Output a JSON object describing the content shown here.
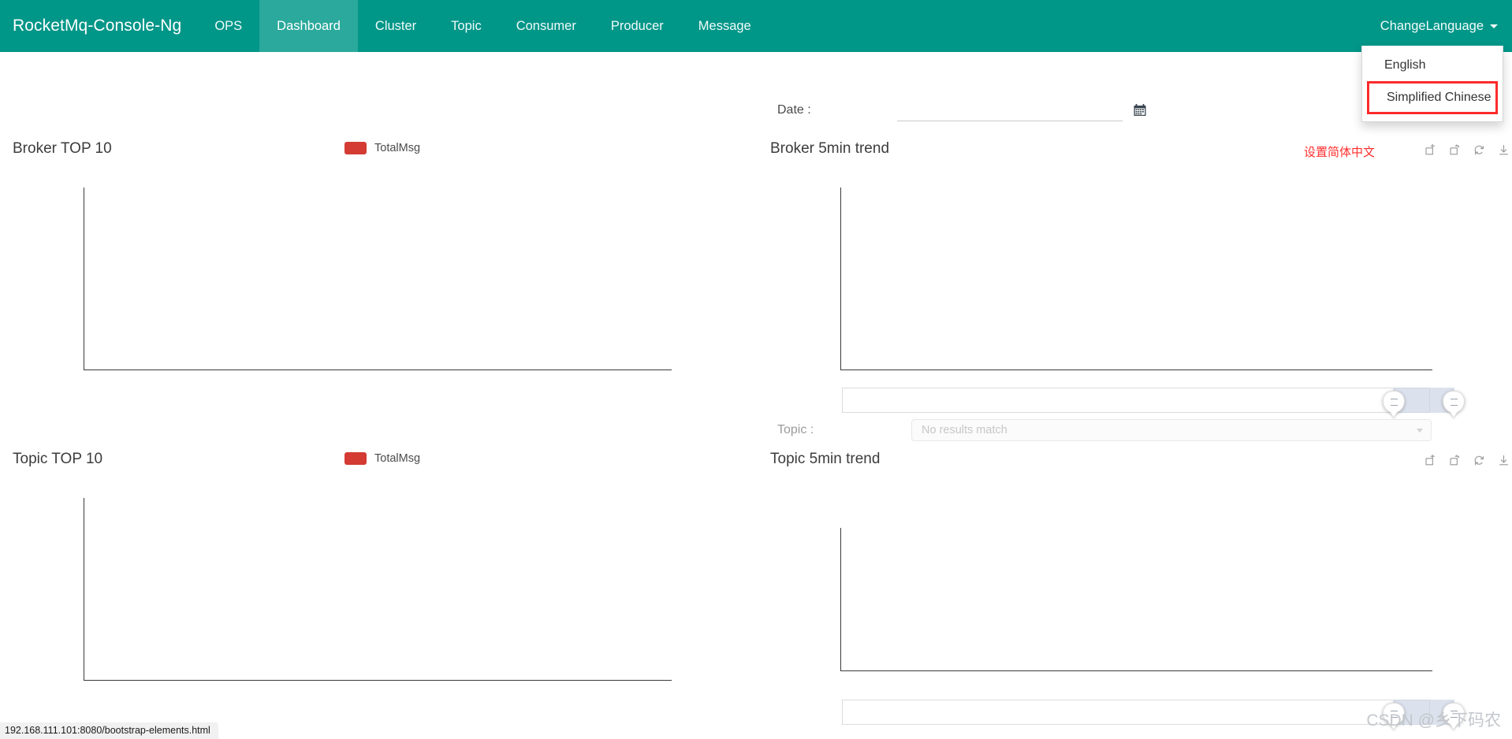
{
  "navbar": {
    "brand": "RocketMq-Console-Ng",
    "bg_color": "#009688",
    "active_color": "#2aa99c",
    "links": [
      {
        "label": "OPS",
        "active": false
      },
      {
        "label": "Dashboard",
        "active": true
      },
      {
        "label": "Cluster",
        "active": false
      },
      {
        "label": "Topic",
        "active": false
      },
      {
        "label": "Consumer",
        "active": false
      },
      {
        "label": "Producer",
        "active": false
      },
      {
        "label": "Message",
        "active": false
      }
    ],
    "language_toggle": "ChangeLanguage"
  },
  "language_menu": {
    "open": true,
    "items": [
      {
        "label": "English",
        "highlighted": false
      },
      {
        "label": "Simplified Chinese",
        "highlighted": true
      }
    ],
    "highlight_color": "#fc2b2b"
  },
  "filters": {
    "date_label": "Date :",
    "date_value": "",
    "date_placeholder": "",
    "calendar_icon": "calendar-icon",
    "topic_label": "Topic :",
    "topic_value": "No results match",
    "topic_options": [
      "No results match"
    ]
  },
  "annotation": {
    "text": "设置简体中文",
    "color": "#ff2d2d"
  },
  "toolbox": {
    "icons": [
      "data-zoom-icon",
      "data-zoom-reset-icon",
      "restore-icon",
      "save-image-icon"
    ]
  },
  "panels": {
    "broker_top10": {
      "title": "Broker TOP 10",
      "legend": [
        {
          "label": "TotalMsg",
          "color": "#d33b33"
        }
      ]
    },
    "broker_trend": {
      "title": "Broker 5min trend",
      "datazoom": {
        "start_pct": 93.5,
        "end_pct": 100
      }
    },
    "topic_top10": {
      "title": "Topic TOP 10",
      "legend": [
        {
          "label": "TotalMsg",
          "color": "#d33b33"
        }
      ]
    },
    "topic_trend": {
      "title": "Topic 5min trend",
      "datazoom": {
        "start_pct": 93.5,
        "end_pct": 100
      }
    }
  },
  "chart_data": [
    {
      "id": "broker-top10",
      "type": "bar",
      "title": "Broker TOP 10",
      "categories": [],
      "series": [
        {
          "name": "TotalMsg",
          "values": [],
          "color": "#d33b33"
        }
      ],
      "xlabel": "",
      "ylabel": "",
      "grid": false,
      "legend_position": "top-right",
      "note": "empty chart - axes only, no data rendered"
    },
    {
      "id": "broker-5min-trend",
      "type": "line",
      "title": "Broker 5min trend",
      "x": [],
      "series": [
        {
          "name": "",
          "values": []
        }
      ],
      "xlabel": "",
      "ylabel": "",
      "grid": false,
      "note": "empty chart - axes only, no data rendered"
    },
    {
      "id": "topic-top10",
      "type": "bar",
      "title": "Topic TOP 10",
      "categories": [],
      "series": [
        {
          "name": "TotalMsg",
          "values": [],
          "color": "#d33b33"
        }
      ],
      "xlabel": "",
      "ylabel": "",
      "grid": false,
      "legend_position": "top-right",
      "note": "empty chart - axes only, no data rendered"
    },
    {
      "id": "topic-5min-trend",
      "type": "line",
      "title": "Topic 5min trend",
      "x": [],
      "series": [
        {
          "name": "",
          "values": []
        }
      ],
      "xlabel": "",
      "ylabel": "",
      "grid": false,
      "note": "empty chart - axes only, no data rendered"
    }
  ],
  "statusbar": {
    "url": "192.168.111.101:8080/bootstrap-elements.html"
  },
  "watermark": {
    "text": "CSDN @乡下码农"
  }
}
